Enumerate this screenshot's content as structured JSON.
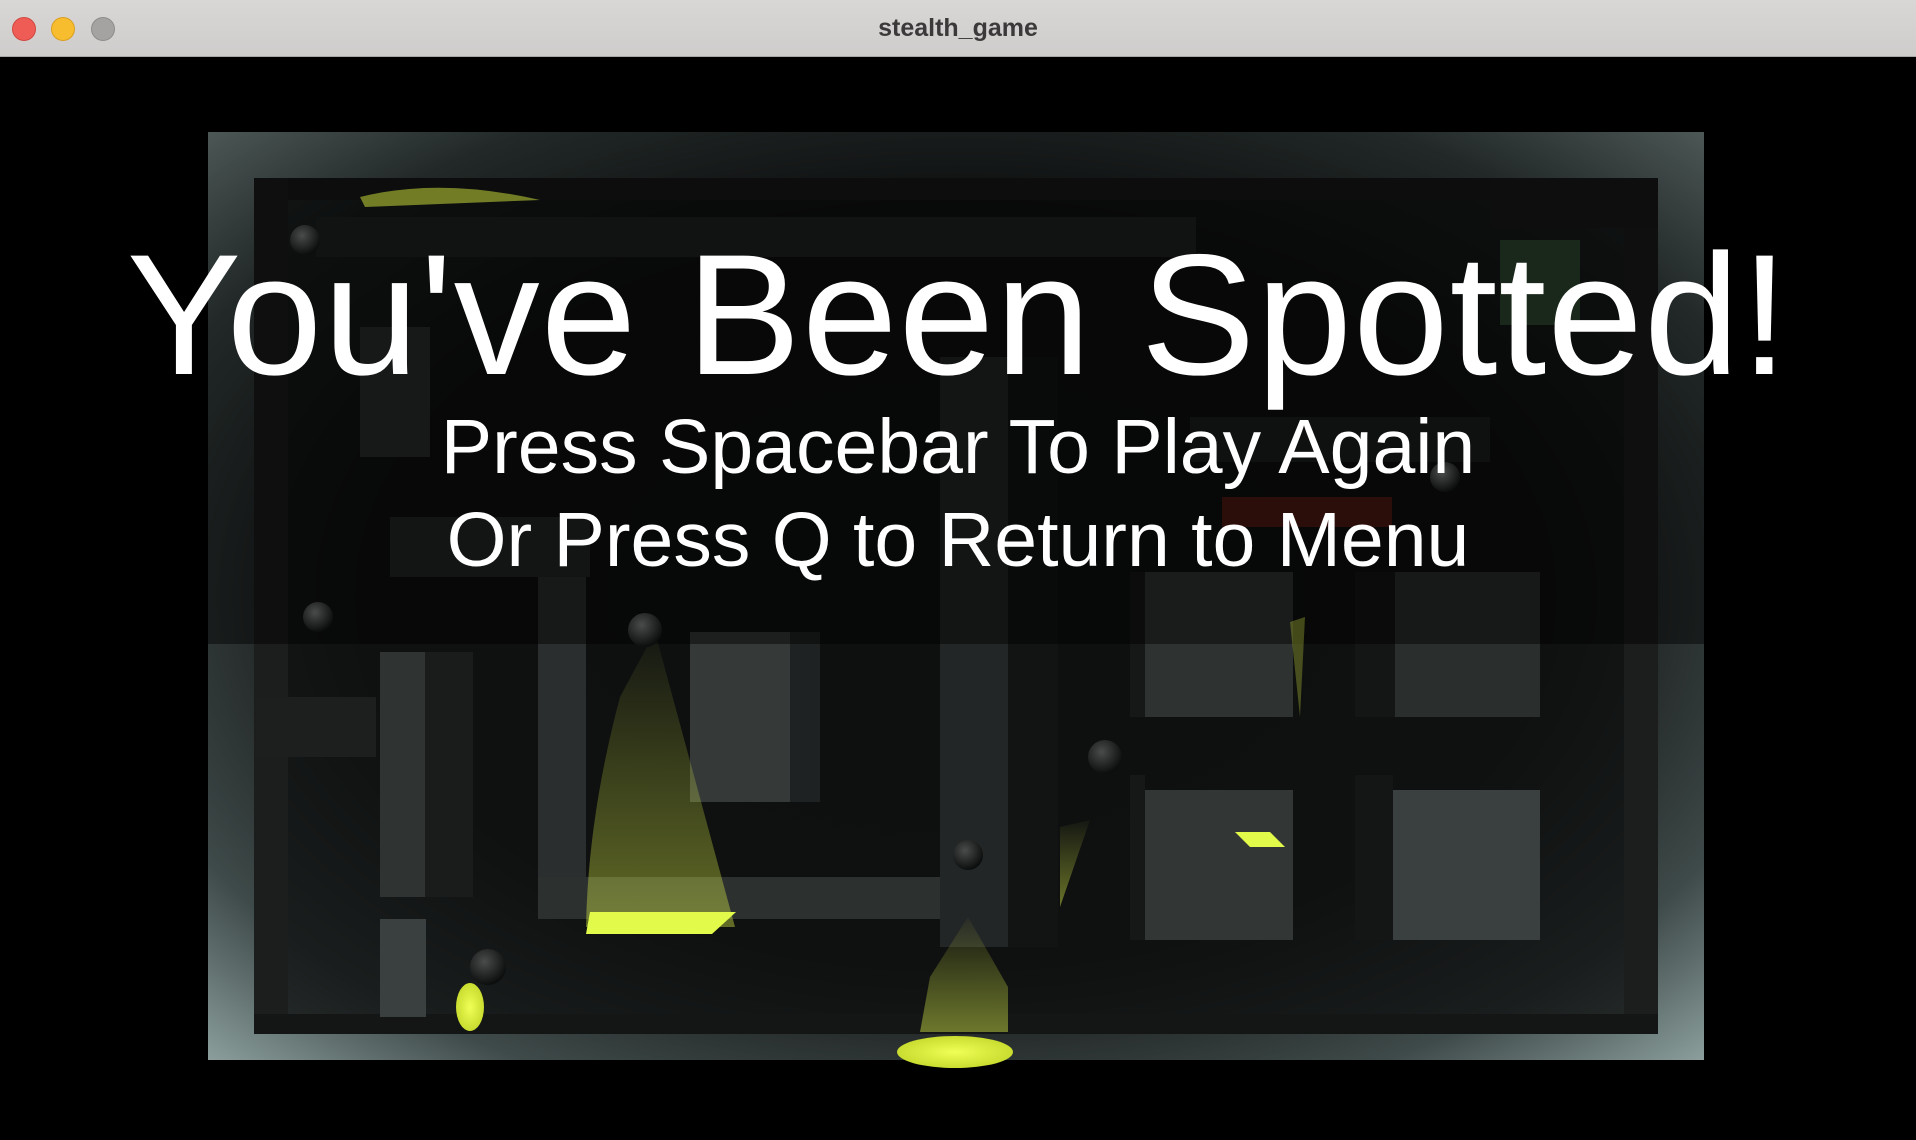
{
  "window": {
    "title": "stealth_game",
    "controls": [
      "close",
      "minimize",
      "maximize"
    ]
  },
  "overlay": {
    "headline": "You've Been Spotted!",
    "line1": "Press Spacebar To Play Again",
    "line2": "Or Press Q to Return to Menu"
  },
  "colors": {
    "spotlight": "#e8ff4a",
    "floor": "#7f9a98",
    "wall": "#1a1b1b",
    "alert": "#6b1a14"
  },
  "icons": {
    "guard": "sphere-guard-icon"
  }
}
